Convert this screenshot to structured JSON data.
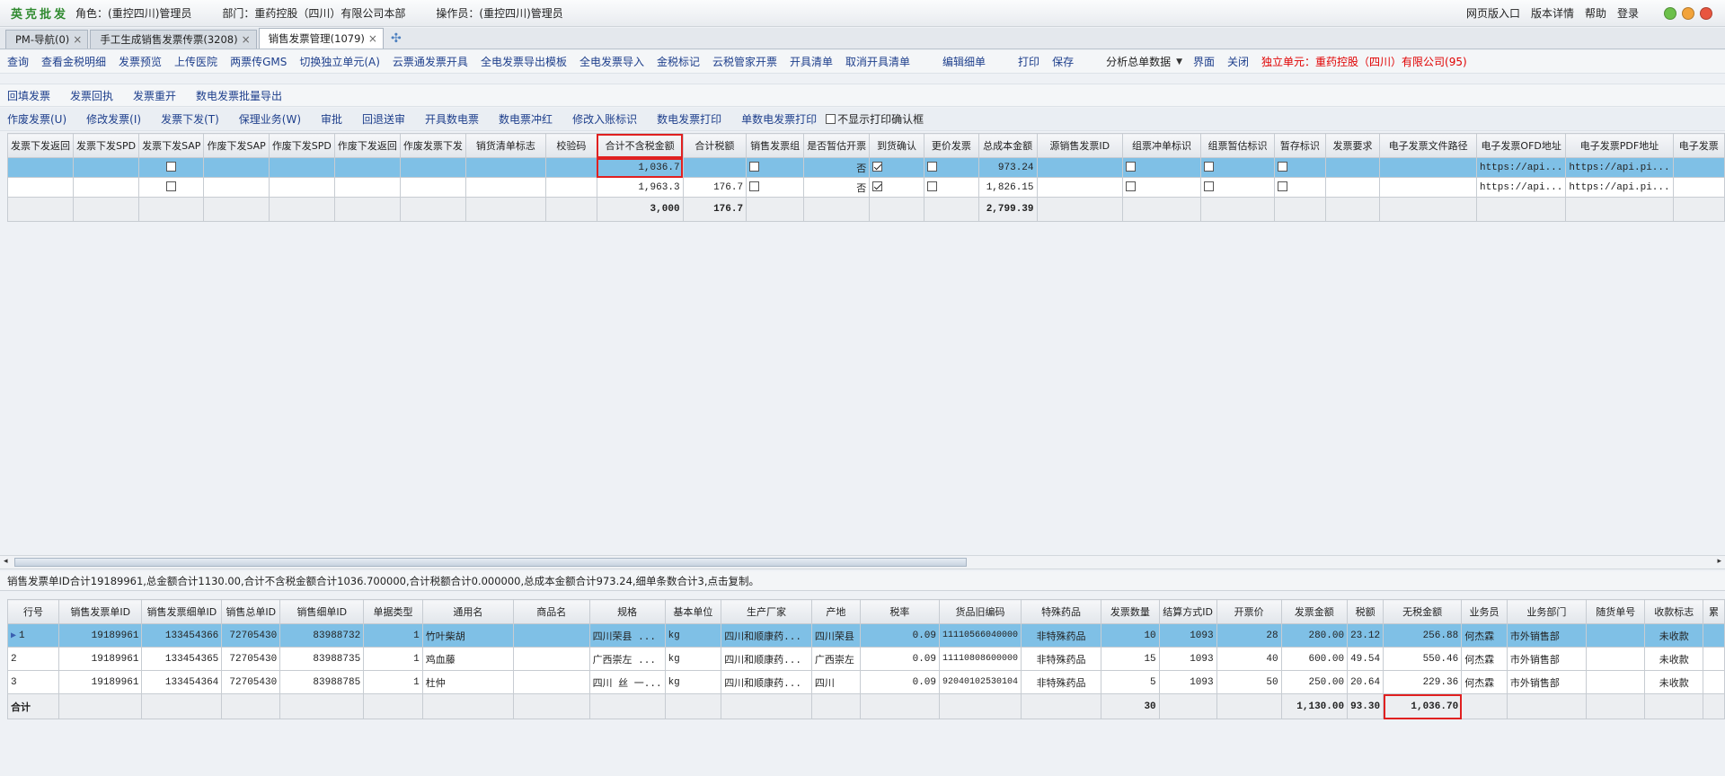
{
  "topbar": {
    "brand": "英克批发",
    "role": "角色：(重控四川)管理员",
    "dept": "部门：重药控股（四川）有限公司本部",
    "operator": "操作员：(重控四川)管理员",
    "links": [
      "网页版入口",
      "版本详情",
      "帮助",
      "登录"
    ],
    "window_colors": [
      "#6cc04a",
      "#f2a33a",
      "#e8553f"
    ]
  },
  "tabs": [
    {
      "label": "PM-导航(0)",
      "close": "×"
    },
    {
      "label": "手工生成销售发票传票(3208)",
      "close": "×"
    },
    {
      "label": "销售发票管理(1079)",
      "close": "×"
    }
  ],
  "menu1": {
    "items": [
      "查询",
      "查看金税明细",
      "发票预览",
      "上传医院",
      "两票传GMS",
      "切换独立单元(A)",
      "云票通发票开具",
      "全电发票导出模板",
      "全电发票导入",
      "金税标记",
      "云税管家开票",
      "开具清单",
      "取消开具清单",
      "编辑细单",
      "打印",
      "保存",
      "分析总单数据",
      "界面",
      "关闭"
    ],
    "dropdown_glyph": "▼",
    "unit_label": "独立单元：重药控股（四川）有限公司(95)"
  },
  "menu2": {
    "items": [
      "回填发票",
      "发票回执",
      "发票重开",
      "数电发票批量导出"
    ]
  },
  "menu3": {
    "items": [
      "作废发票(U)",
      "修改发票(I)",
      "发票下发(T)",
      "保理业务(W)",
      "审批",
      "回退送审",
      "开具数电票",
      "数电票冲红",
      "修改入账标识",
      "数电发票打印",
      "单数电发票打印"
    ],
    "checkbox_label": "不显示打印确认框"
  },
  "grid1": {
    "headers": [
      "发票下发返回",
      "发票下发SPD",
      "发票下发SAP",
      "作废下发SAP",
      "作废下发SPD",
      "作废下发返回",
      "作废发票下发",
      "销货清单标志",
      "校验码",
      "合计不含税金额",
      "合计税额",
      "销售发票组",
      "是否暂估开票",
      "到货确认",
      "更价发票",
      "总成本金额",
      "源销售发票ID",
      "组票冲单标识",
      "组票暂估标识",
      "暂存标识",
      "发票要求",
      "电子发票文件路径",
      "电子发票OFD地址",
      "电子发票PDF地址",
      "电子发票"
    ],
    "rows": [
      {
        "amount": "1,036.7",
        "tax": "",
        "estimate": "否",
        "cost": "973.24",
        "ofd": "https://api...",
        "pdf": "https://api.pi..."
      },
      {
        "amount": "1,963.3",
        "tax": "176.7",
        "estimate": "否",
        "cost": "1,826.15",
        "ofd": "https://api...",
        "pdf": "https://api.pi..."
      }
    ],
    "total": {
      "amount": "3,000",
      "tax": "176.7",
      "cost": "2,799.39"
    }
  },
  "scroll": {
    "left": "◂",
    "right": "▸"
  },
  "status_text": "销售发票单ID合计19189961,总金额合计1130.00,合计不含税金额合计1036.700000,合计税额合计0.000000,总成本金额合计973.24,细单条数合计3,点击复制。",
  "grid2": {
    "headers": [
      "行号",
      "销售发票单ID",
      "销售发票细单ID",
      "销售总单ID",
      "销售细单ID",
      "单据类型",
      "通用名",
      "商品名",
      "规格",
      "基本单位",
      "生产厂家",
      "产地",
      "税率",
      "货品旧编码",
      "特殊药品",
      "发票数量",
      "结算方式ID",
      "开票价",
      "发票金额",
      "税额",
      "无税金额",
      "业务员",
      "业务部门",
      "随货单号",
      "收款标志",
      "累"
    ],
    "rows": [
      [
        "1",
        "19189961",
        "133454366",
        "72705430",
        "83988732",
        "1",
        "竹叶柴胡",
        "",
        "四川荣县 ...",
        "kg",
        "四川和顺康药...",
        "四川荣县",
        "0.09",
        "11110566040000",
        "非特殊药品",
        "10",
        "1093",
        "28",
        "280.00",
        "23.12",
        "256.88",
        "何杰霖",
        "市外销售部",
        "",
        "未收款",
        ""
      ],
      [
        "2",
        "19189961",
        "133454365",
        "72705430",
        "83988735",
        "1",
        "鸡血藤",
        "",
        "广西崇左 ...",
        "kg",
        "四川和顺康药...",
        "广西崇左",
        "0.09",
        "11110808600000",
        "非特殊药品",
        "15",
        "1093",
        "40",
        "600.00",
        "49.54",
        "550.46",
        "何杰霖",
        "市外销售部",
        "",
        "未收款",
        ""
      ],
      [
        "3",
        "19189961",
        "133454364",
        "72705430",
        "83988785",
        "1",
        "杜仲",
        "",
        "四川 丝 一...",
        "kg",
        "四川和顺康药...",
        "四川",
        "0.09",
        "92040102530104",
        "非特殊药品",
        "5",
        "1093",
        "50",
        "250.00",
        "20.64",
        "229.36",
        "何杰霖",
        "市外销售部",
        "",
        "未收款",
        ""
      ]
    ],
    "total": {
      "label": "合计",
      "qty": "30",
      "amount": "1,130.00",
      "tax": "93.30",
      "notax": "1,036.70"
    }
  }
}
